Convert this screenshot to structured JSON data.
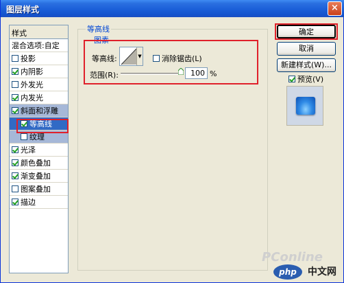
{
  "window": {
    "title": "图层样式",
    "close_glyph": "×"
  },
  "styles_list": {
    "header": "样式",
    "items": [
      {
        "label": "混合选项:自定",
        "checkbox": null
      },
      {
        "label": "投影",
        "checked": false
      },
      {
        "label": "内阴影",
        "checked": true
      },
      {
        "label": "外发光",
        "checked": false
      },
      {
        "label": "内发光",
        "checked": true
      },
      {
        "label": "斜面和浮雕",
        "checked": true
      },
      {
        "label": "等高线",
        "checked": true
      },
      {
        "label": "纹理",
        "checked": false
      },
      {
        "label": "光泽",
        "checked": true
      },
      {
        "label": "颜色叠加",
        "checked": true
      },
      {
        "label": "渐变叠加",
        "checked": true
      },
      {
        "label": "图案叠加",
        "checked": false
      },
      {
        "label": "描边",
        "checked": true
      }
    ]
  },
  "panel": {
    "group_title": "等高线",
    "sub_title": "图素",
    "contour_label": "等高线:",
    "anti_alias_label": "消除锯齿(L)",
    "anti_alias_checked": false,
    "range_label": "范围(R):",
    "range_value": "100",
    "range_unit": "%"
  },
  "buttons": {
    "ok": "确定",
    "cancel": "取消",
    "new_style": "新建样式(W)...",
    "preview_label": "预览(V)",
    "preview_checked": true
  },
  "watermark": {
    "pconline": "PConline",
    "php": "php",
    "cn": "中文网"
  },
  "colors": {
    "title_bar": "#1b5fd8",
    "highlight_red": "#e0202a",
    "selected_item": "#316ac5"
  }
}
